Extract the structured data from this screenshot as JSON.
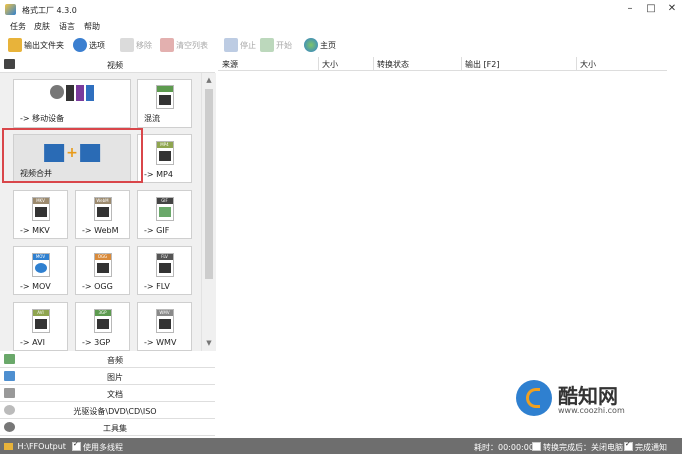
{
  "window": {
    "title": "格式工厂 4.3.0"
  },
  "menu": [
    "任务",
    "皮肤",
    "语言",
    "帮助"
  ],
  "toolbar": {
    "output_folder": "输出文件夹",
    "options": "选项",
    "remove": "移除",
    "clear_list": "清空列表",
    "stop": "停止",
    "start": "开始",
    "home": "主页"
  },
  "categories": {
    "video": "视频",
    "audio": "音频",
    "picture": "图片",
    "document": "文档",
    "optical": "光驱设备\\DVD\\CD\\ISO",
    "tools": "工具集"
  },
  "tiles": [
    {
      "label": "-> 移动设备",
      "icon": "mobile-devices-icon"
    },
    {
      "label": "混流",
      "icon": "mux-icon"
    },
    {
      "label": "视频合并",
      "icon": "video-join-icon"
    },
    {
      "label": "-> MP4",
      "icon": "mp4-file-icon",
      "badge": "MP4"
    },
    {
      "label": "-> MKV",
      "icon": "mkv-file-icon",
      "badge": "MKV"
    },
    {
      "label": "-> WebM",
      "icon": "webm-file-icon",
      "badge": "WebM"
    },
    {
      "label": "-> GIF",
      "icon": "gif-file-icon",
      "badge": "GIF"
    },
    {
      "label": "-> MOV",
      "icon": "mov-file-icon",
      "badge": "MOV"
    },
    {
      "label": "-> OGG",
      "icon": "ogg-file-icon",
      "badge": "OGG"
    },
    {
      "label": "-> FLV",
      "icon": "flv-file-icon",
      "badge": "FLV"
    },
    {
      "label": "-> AVI",
      "icon": "avi-file-icon",
      "badge": "AVI"
    },
    {
      "label": "-> 3GP",
      "icon": "3gp-file-icon",
      "badge": "3GP"
    },
    {
      "label": "-> WMV",
      "icon": "wmv-file-icon",
      "badge": "WMV"
    }
  ],
  "columns": [
    "来源",
    "大小",
    "转换状态",
    "输出 [F2]",
    "大小"
  ],
  "status": {
    "output_path": "H:\\FFOutput",
    "multithread": "使用多线程",
    "elapsed": "耗时：00:00:00",
    "after_convert": "转换完成后：关闭电脑",
    "notify": "完成通知"
  },
  "watermark": {
    "brand": "酷知网",
    "url": "www.coozhi.com"
  },
  "colors": {
    "highlight": "#d9464a",
    "statusbar": "#6e6e6e",
    "accent_blue": "#2f80d0"
  }
}
